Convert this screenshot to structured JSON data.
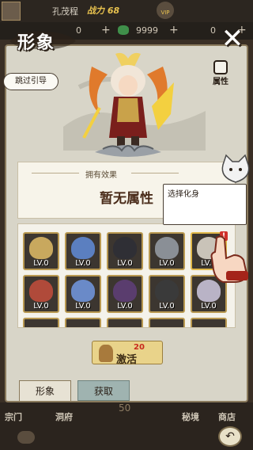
{
  "topbar": {
    "player_name": "孔茂程",
    "power_label": "战力 68",
    "vip_label": "VIP",
    "currency1_value": "0",
    "currency2_value": "9999",
    "currency3_value": "0"
  },
  "panel": {
    "title": "形象",
    "skip_guide_label": "跳过引导",
    "attributes_label": "属性",
    "effects_header": "拥有效果",
    "effects_value": "暂无属性"
  },
  "guide": {
    "bubble_text": "选择化身"
  },
  "grid": {
    "cards": [
      {
        "level": "LV.0",
        "color": "#c8a85e"
      },
      {
        "level": "LV.0",
        "color": "#5b7fc0"
      },
      {
        "level": "LV.0",
        "color": "#2f2f35"
      },
      {
        "level": "LV.0",
        "color": "#8a8f96"
      },
      {
        "level": "LV.0",
        "color": "#c9c3b8"
      },
      {
        "level": "LV.0",
        "color": "#b04a3a"
      },
      {
        "level": "LV.0",
        "color": "#6a8ac8"
      },
      {
        "level": "LV.0",
        "color": "#5a3d6e"
      },
      {
        "level": "LV.0",
        "color": "#3a3a3a"
      },
      {
        "level": "LV.0",
        "color": "#b9b3c6"
      }
    ],
    "alert_mark": "!"
  },
  "activate": {
    "label": "激活",
    "count": "20"
  },
  "tabs": {
    "tab1": "形象",
    "tab2": "获取"
  },
  "bottomnav": {
    "item1": "宗门",
    "item2": "洞府",
    "item3": "秘境",
    "item4": "商店",
    "center_number": "50"
  }
}
